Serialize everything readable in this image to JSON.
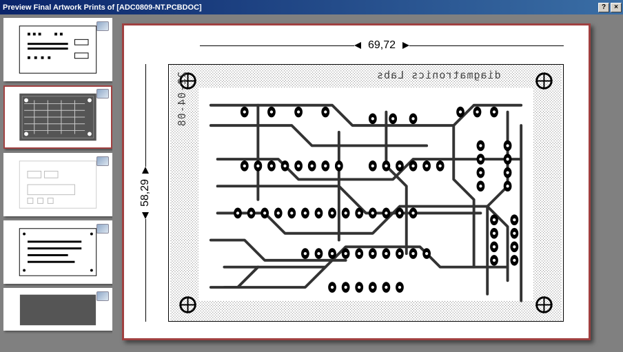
{
  "window": {
    "title": "Preview Final Artwork Prints of [ADC0809-NT.PCBDOC]",
    "help_glyph": "?",
    "close_glyph": "×"
  },
  "thumbnails": [
    {
      "id": 1,
      "selected": false
    },
    {
      "id": 2,
      "selected": true
    },
    {
      "id": 3,
      "selected": false
    },
    {
      "id": 4,
      "selected": false
    },
    {
      "id": 5,
      "selected": false
    }
  ],
  "board": {
    "width_label": "69,72",
    "height_label": "58,29",
    "silk_top": "diagmatronics Labs",
    "silk_date": "22-04-08"
  }
}
